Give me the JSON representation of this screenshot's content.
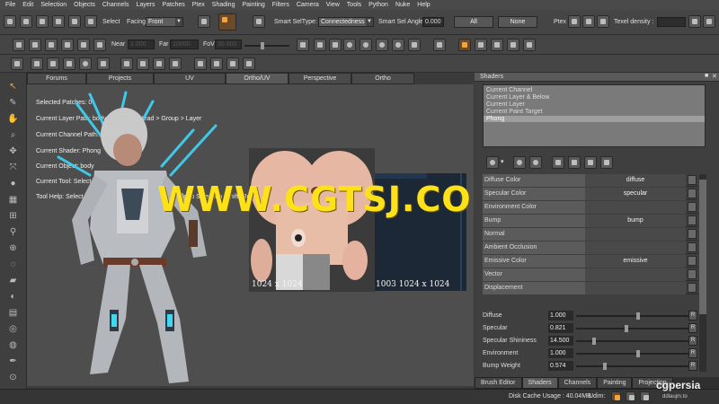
{
  "menu": [
    "File",
    "Edit",
    "Selection",
    "Objects",
    "Channels",
    "Layers",
    "Patches",
    "Ptex",
    "Shading",
    "Painting",
    "Filters",
    "Camera",
    "View",
    "Tools",
    "Python",
    "Nuke",
    "Help"
  ],
  "toolbar1": {
    "select_label": "Select",
    "facing_label": "Facing",
    "facing_value": "Front",
    "smart_seltype_label": "Smart SelType:",
    "smart_seltype_value": "Connectedness",
    "smart_sel_angle_label": "Smart Sel Angle",
    "smart_sel_angle_value": "0.000",
    "all_label": "All",
    "none_label": "None",
    "ptex_label": "Ptex",
    "texel_density_label": "Texel density :"
  },
  "toolbar2": {
    "near_label": "Near",
    "near_value": "1.000",
    "far_label": "Far",
    "far_value": "10000",
    "fov_label": "FoV",
    "fov_value": "30.000"
  },
  "view_tabs": [
    "Forums",
    "Projects",
    "UV",
    "Ortho/UV",
    "Perspective",
    "Ortho"
  ],
  "active_view_tab": "Ortho/UV",
  "viewport_info": {
    "selected_patches": "Selected Patches: 0",
    "layer_path": "Current Layer Path: body > diffuse > Head > Group > Layer",
    "channel_path": "Current Channel Path: body > diffuse",
    "shader": "Current Shader: Phong",
    "object": "Current Object: body",
    "tool": "Current Tool: Select (S)",
    "tool_help": "Tool Help: Select All (Ctrl+A)   Select None (Ctrl+E)   Add to Selection (Shift)   Remove from Selection (Ctrl)"
  },
  "uv_patch_labels": [
    "1024 x 1024",
    "1003 1024 x 1024"
  ],
  "watermark": "WWW.CGTSJ.COM",
  "shaders_panel": {
    "title": "Shaders",
    "list": [
      "Current Channel",
      "Current Layer & Below",
      "Current Layer",
      "Current Paint Target",
      "Phong"
    ],
    "selected": "Phong",
    "properties": [
      {
        "name": "Diffuse Color",
        "value": "diffuse"
      },
      {
        "name": "Specular Color",
        "value": "specular"
      },
      {
        "name": "Environment Color",
        "value": ""
      },
      {
        "name": "Bump",
        "value": "bump"
      },
      {
        "name": "Normal",
        "value": ""
      },
      {
        "name": "Ambient Occlusion",
        "value": ""
      },
      {
        "name": "Emissive Color",
        "value": "emissive"
      },
      {
        "name": "Vector",
        "value": ""
      },
      {
        "name": "Displacement",
        "value": ""
      }
    ],
    "numeric": [
      {
        "name": "Diffuse",
        "value": "1.000",
        "level": 0.55
      },
      {
        "name": "Specular",
        "value": "0.821",
        "level": 0.45
      },
      {
        "name": "Specular Shininess",
        "value": "14.500",
        "level": 0.15
      },
      {
        "name": "Environment",
        "value": "1.000",
        "level": 0.55
      },
      {
        "name": "Bump Weight",
        "value": "0.574",
        "level": 0.25
      }
    ],
    "r_label": "R"
  },
  "bottom_tabs": [
    "Brush Editor",
    "Shaders",
    "Channels",
    "Painting",
    "Projection"
  ],
  "active_bottom_tab": "Shaders",
  "status": {
    "disk_cache": "Disk Cache Usage : 40.04MB",
    "udim_label": "Udim:"
  },
  "branding": {
    "logo": "cgpersia",
    "caption": "ddlaujm.to"
  },
  "colors": {
    "accent_orange": "#f2a43a",
    "watermark_yellow": "#ffe11a"
  }
}
